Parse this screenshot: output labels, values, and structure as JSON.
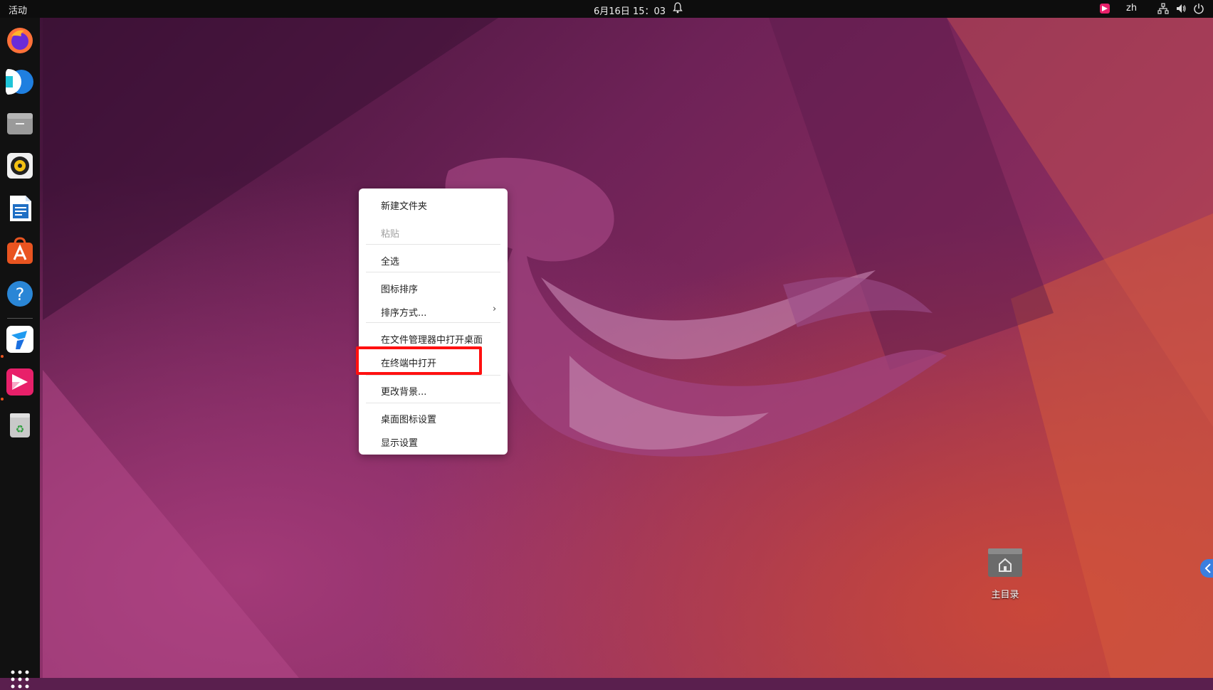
{
  "topbar": {
    "activities": "活动",
    "clock": "6月16日 15：03",
    "language": "zh"
  },
  "dock": {
    "apps": [
      {
        "name": "firefox"
      },
      {
        "name": "thunderbird"
      },
      {
        "name": "files"
      },
      {
        "name": "rhythmbox"
      },
      {
        "name": "libreoffice-writer"
      },
      {
        "name": "software-center"
      },
      {
        "name": "help"
      },
      {
        "name": "todesk"
      },
      {
        "name": "sunlogin"
      },
      {
        "name": "trash"
      }
    ]
  },
  "context_menu": {
    "items": [
      {
        "label": "新建文件夹",
        "enabled": true
      },
      {
        "label": "粘贴",
        "enabled": false
      },
      {
        "label": "全选",
        "enabled": true
      },
      {
        "label": "图标排序",
        "enabled": true
      },
      {
        "label": "排序方式...",
        "enabled": true,
        "submenu": true
      },
      {
        "label": "在文件管理器中打开桌面",
        "enabled": true
      },
      {
        "label": "在终端中打开",
        "enabled": true,
        "highlighted": true
      },
      {
        "label": "更改背景...",
        "enabled": true
      },
      {
        "label": "桌面图标设置",
        "enabled": true
      },
      {
        "label": "显示设置",
        "enabled": true
      }
    ],
    "submenu_arrow": "›"
  },
  "desktop": {
    "home_label": "主目录"
  },
  "colors": {
    "highlight": "#ff1010",
    "accent": "#e95420",
    "topbar": "#0d0d0d"
  }
}
